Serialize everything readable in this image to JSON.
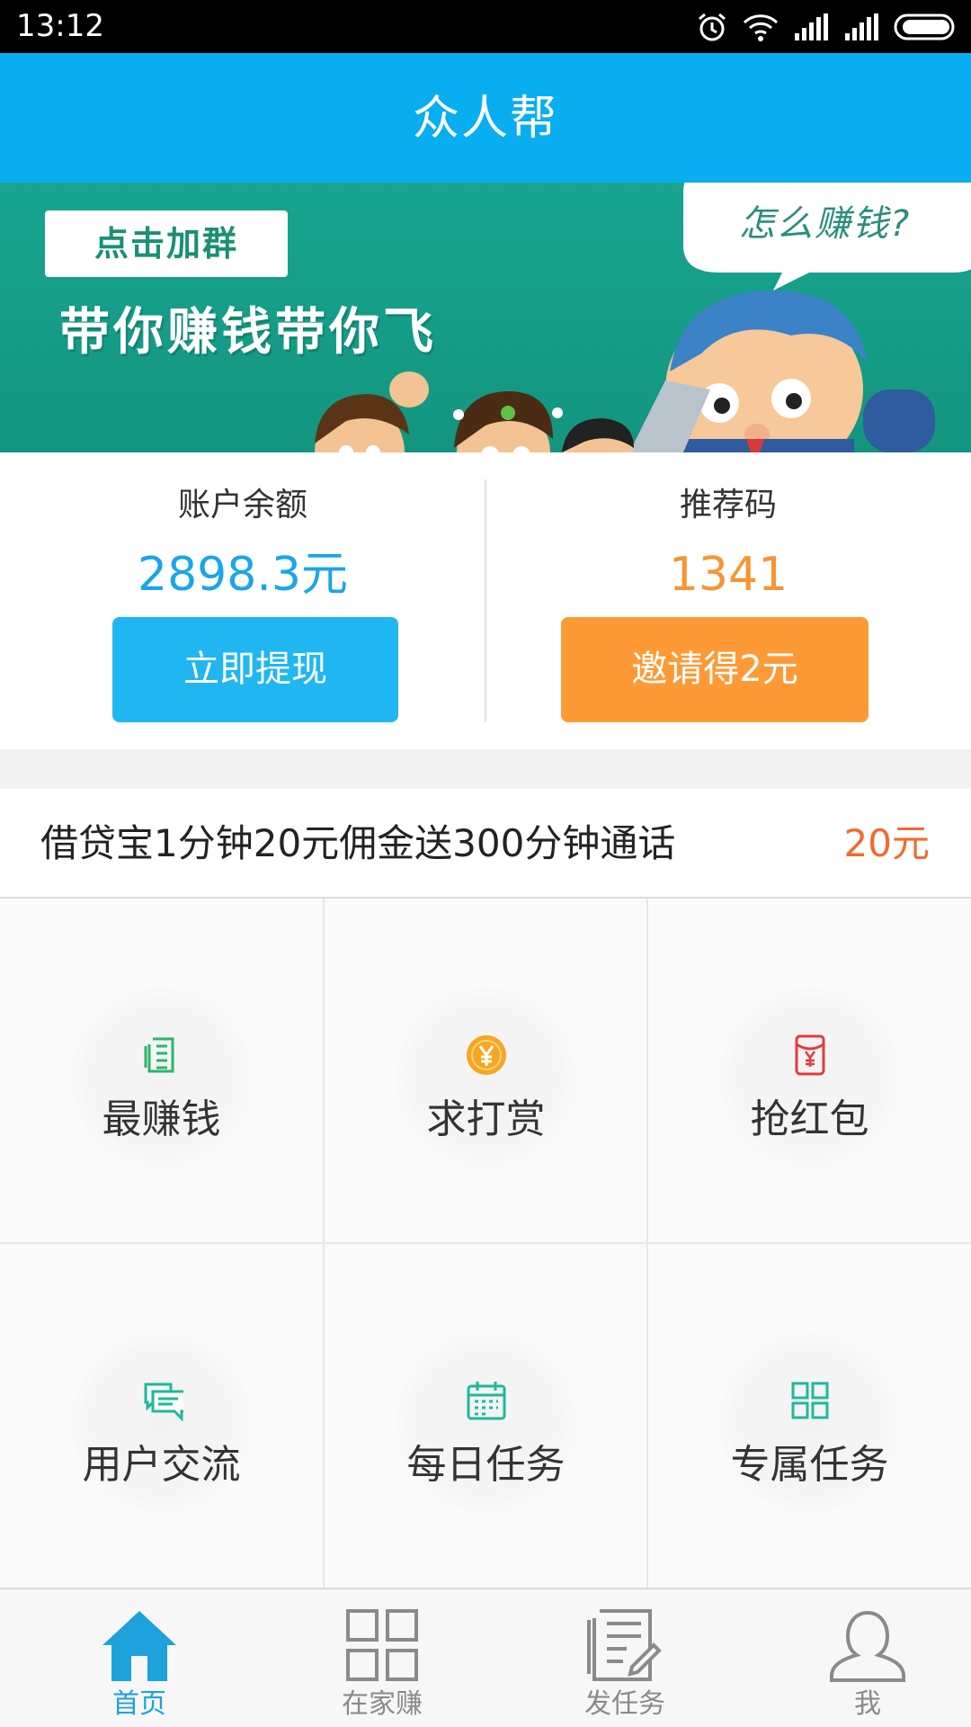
{
  "status_bar": {
    "time": "13:12",
    "icons": [
      "alarm-icon",
      "wifi-icon",
      "signal-icon",
      "signal-icon",
      "battery-icon"
    ]
  },
  "header": {
    "title": "众人帮"
  },
  "banner": {
    "tag": "点击加群",
    "slogan": "带你赚钱带你飞",
    "bubble": "怎么赚钱?"
  },
  "account": {
    "balance_label": "账户余额",
    "balance_value": "2898.3元",
    "withdraw_button": "立即提现",
    "referral_label": "推荐码",
    "referral_value": "1341",
    "invite_button": "邀请得2元"
  },
  "promo": {
    "text": "借贷宝1分钟20元佣金送300分钟通话",
    "amount": "20元"
  },
  "menu": [
    {
      "label": "最赚钱",
      "icon": "document-list-icon",
      "color": "#2bb56b"
    },
    {
      "label": "求打赏",
      "icon": "coin-yen-icon",
      "color": "#f5a623"
    },
    {
      "label": "抢红包",
      "icon": "red-envelope-icon",
      "color": "#e23c3c"
    },
    {
      "label": "用户交流",
      "icon": "chat-icon",
      "color": "#1fb89c"
    },
    {
      "label": "每日任务",
      "icon": "calendar-icon",
      "color": "#1fb89c"
    },
    {
      "label": "专属任务",
      "icon": "grid-icon",
      "color": "#1fb89c"
    }
  ],
  "nav": [
    {
      "label": "首页",
      "icon": "home-icon",
      "active": true
    },
    {
      "label": "在家赚",
      "icon": "grid-icon",
      "active": false
    },
    {
      "label": "发任务",
      "icon": "edit-document-icon",
      "active": false
    },
    {
      "label": "我",
      "icon": "user-icon",
      "active": false
    }
  ],
  "colors": {
    "primary": "#08aef0",
    "balance": "#1ba5ea",
    "referral": "#f79433",
    "withdraw_button": "#20b6f2",
    "invite_button": "#fe9a35",
    "promo_amount": "#f46a2c",
    "active_nav": "#1da2dc",
    "banner_bg": "#17a58f"
  }
}
